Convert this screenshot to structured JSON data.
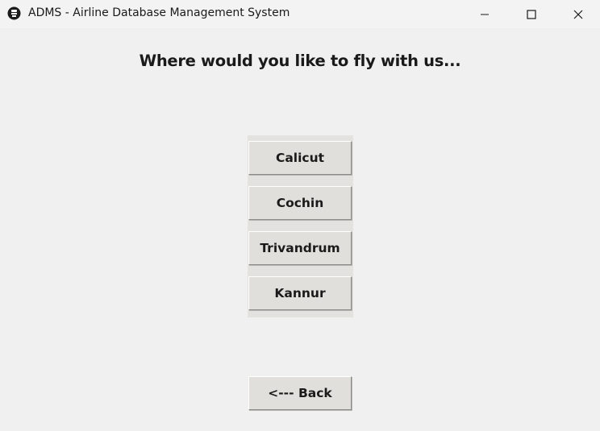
{
  "window": {
    "title": "ADMS - Airline Database Management System"
  },
  "main": {
    "heading": "Where would you like to fly with us...",
    "destinations": [
      "Calicut",
      "Cochin",
      "Trivandrum",
      "Kannur"
    ],
    "back_label": "<--- Back"
  },
  "icons": {
    "app": "app-icon",
    "minimize": "minimize-icon",
    "maximize": "maximize-icon",
    "close": "close-icon"
  }
}
